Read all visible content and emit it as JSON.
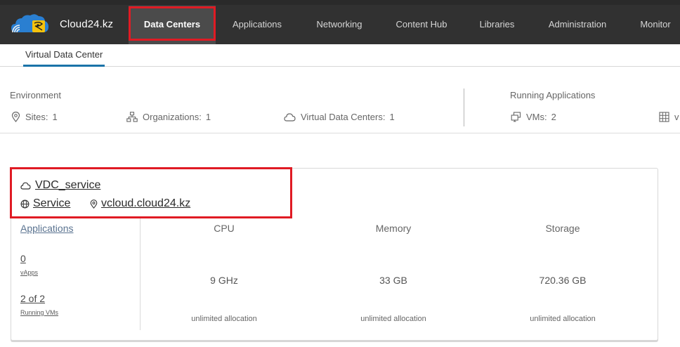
{
  "header": {
    "brand": "Cloud24.kz",
    "nav": [
      {
        "label": "Data Centers",
        "active": true
      },
      {
        "label": "Applications"
      },
      {
        "label": "Networking"
      },
      {
        "label": "Content Hub"
      },
      {
        "label": "Libraries"
      },
      {
        "label": "Administration"
      },
      {
        "label": "Monitor"
      }
    ]
  },
  "subtabs": [
    {
      "label": "Virtual Data Center",
      "active": true
    }
  ],
  "summary": {
    "environment_title": "Environment",
    "running_title": "Running Applications",
    "sites": {
      "label": "Sites:",
      "value": "1",
      "icon": "location-pin-icon"
    },
    "organizations": {
      "label": "Organizations:",
      "value": "1",
      "icon": "org-tree-icon"
    },
    "vdcs": {
      "label": "Virtual Data Centers:",
      "value": "1",
      "icon": "cloud-icon"
    },
    "vms": {
      "label": "VMs:",
      "value": "2",
      "icon": "vm-stack-icon"
    },
    "partial_item": {
      "label": "v",
      "icon": "grid-icon"
    }
  },
  "vdc_card": {
    "name": "VDC_service",
    "org": "Service",
    "site": "vcloud.cloud24.kz",
    "applications_label": "Applications",
    "vapps": {
      "value": "0",
      "caption": "vApps"
    },
    "running_vms": {
      "value": "2 of 2",
      "caption": "Running VMs"
    },
    "metrics": [
      {
        "name": "CPU",
        "value": "9 GHz",
        "allocation": "unlimited allocation"
      },
      {
        "name": "Memory",
        "value": "33 GB",
        "allocation": "unlimited allocation"
      },
      {
        "name": "Storage",
        "value": "720.36 GB",
        "allocation": "unlimited allocation"
      }
    ]
  },
  "colors": {
    "topbar": "#313131",
    "active_nav": "#4b4b4b",
    "highlight": "#e01b24",
    "tab_underline": "#1a73a8"
  }
}
